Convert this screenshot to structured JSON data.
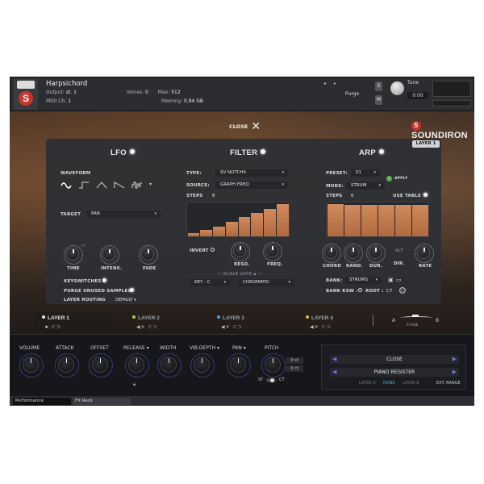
{
  "host": {
    "title": "Harpsichord",
    "output_label": "Output:",
    "output_value": "st. 1",
    "midi_label": "MIDI Ch:",
    "midi_value": "1",
    "voices_label": "Voices:",
    "voices_value": "0",
    "max_label": "Max:",
    "max_value": "512",
    "memory_label": "Memory:",
    "memory_value": "0.94 GB",
    "purge_label": "Purge",
    "tune_label": "Tune",
    "tune_value": "0.00",
    "s_button": "S",
    "m_button": "M"
  },
  "top": {
    "close_label": "CLOSE",
    "brand": "SOUNDIRON",
    "layer_tag": "LAYER 1"
  },
  "lfo": {
    "title": "LFO",
    "waveform_label": "WAVEFORM",
    "target_label": "TARGET",
    "target_value": "PAN",
    "knobs": [
      "TIME",
      "INTENS.",
      "FADE"
    ],
    "keyswitches": "KEYSWITCHES",
    "purge_unused": "PURGE UNUSED SAMPLES",
    "layer_routing": "LAYER ROUTING",
    "routing_value": "DEFAULT"
  },
  "filter": {
    "title": "FILTER",
    "type_label": "TYPE:",
    "type_value": "SV NOTCH4",
    "source_label": "SOURCE:",
    "source_value": "GRAPH FREQ",
    "steps_label": "STEPS",
    "steps_value": "8",
    "step_values": [
      0.1,
      0.2,
      0.3,
      0.45,
      0.6,
      0.72,
      0.85,
      1.0
    ],
    "invert_label": "INVERT",
    "knobs": [
      "RESO.",
      "FREQ."
    ],
    "scale_lock": "SCALE LOCK",
    "key_value": "KEY - C",
    "scale_value": "CHROMATIC"
  },
  "arp": {
    "title": "ARP",
    "preset_label": "PRESET:",
    "preset_value": "01",
    "apply_label": "APPLY",
    "mode_label": "MODE:",
    "mode_value": "STRUM",
    "steps_label": "STEPS",
    "steps_value": "6",
    "use_table": "USE TABLE",
    "step_values": [
      1.0,
      0.97,
      0.97,
      0.97,
      0.97,
      0.97
    ],
    "knobs": [
      "CHORD",
      "RAND.",
      "DUR.",
      "DIR.",
      "RATE"
    ],
    "alt_label": "ALT",
    "bank_label": "BANK:",
    "bank_value": "STRUMS",
    "bank_ksw_label": "BANK KSW :",
    "root_label": "ROOT :",
    "root_value": "C7"
  },
  "layers": [
    {
      "name": "LAYER 1",
      "color": "#e6e6e6"
    },
    {
      "name": "LAYER 2",
      "color": "#9fd04e"
    },
    {
      "name": "LAYER 3",
      "color": "#4aa8e0"
    },
    {
      "name": "LAYER 4",
      "color": "#e0b540"
    }
  ],
  "xfade": {
    "a": "A",
    "label": "X-FADE",
    "b": "B"
  },
  "bottom": {
    "knobs": [
      "VOLUME",
      "ATTACK",
      "OFFSET",
      "RELEASE ▾",
      "WIDTH",
      "VIB.DEPTH ▾",
      "PAN ▾",
      "PITCH"
    ],
    "pitch_st": "ST",
    "pitch_ct": "CT",
    "pitch_box1": "0 st",
    "pitch_box2": "0 ct",
    "close_label": "CLOSE",
    "register_label": "PIANO REGISTER",
    "opt_layer_a": "LAYER A",
    "opt_none": "NONE",
    "opt_layer_b": "LAYER B",
    "ext_range": "EXT. RANGE"
  },
  "tabs": [
    "Performance",
    "FX Rack"
  ]
}
